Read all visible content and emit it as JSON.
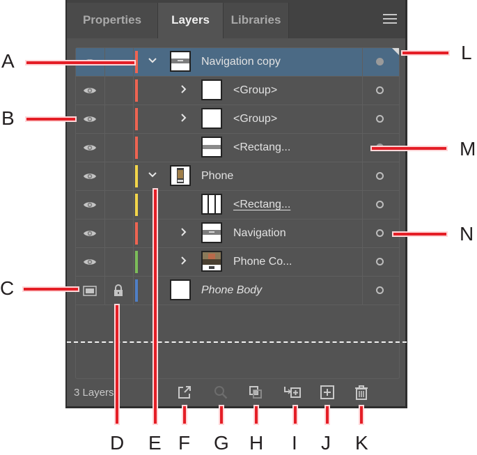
{
  "tabs": [
    {
      "label": "Properties",
      "active": false
    },
    {
      "label": "Layers",
      "active": true
    },
    {
      "label": "Libraries",
      "active": false
    }
  ],
  "menu_icon": "hamburger-menu-icon",
  "layers": [
    {
      "name": "Navigation copy",
      "indent": 0,
      "expanded": true,
      "has_toggle": true,
      "visible": true,
      "locked": false,
      "color": "#ee6452",
      "thumb": "navigation-bar",
      "target_filled": true,
      "selected": true,
      "italic": false,
      "underline": false
    },
    {
      "name": "<Group>",
      "indent": 1,
      "expanded": false,
      "has_toggle": true,
      "visible": true,
      "locked": false,
      "color": "#ee6452",
      "thumb": "blank",
      "target_filled": false,
      "selected": false,
      "italic": false,
      "underline": false
    },
    {
      "name": "<Group>",
      "indent": 1,
      "expanded": false,
      "has_toggle": true,
      "visible": true,
      "locked": false,
      "color": "#ee6452",
      "thumb": "blank",
      "target_filled": false,
      "selected": false,
      "italic": false,
      "underline": false
    },
    {
      "name": "<Rectang...",
      "indent": 1,
      "expanded": false,
      "has_toggle": false,
      "visible": true,
      "locked": false,
      "color": "#ee6452",
      "thumb": "gray-stripe",
      "target_filled": true,
      "selected": false,
      "italic": false,
      "underline": false
    },
    {
      "name": "Phone",
      "indent": 0,
      "expanded": true,
      "has_toggle": true,
      "visible": true,
      "locked": false,
      "color": "#f2d54a",
      "thumb": "phone",
      "target_filled": false,
      "selected": false,
      "italic": false,
      "underline": false
    },
    {
      "name": "<Rectang...",
      "indent": 1,
      "expanded": false,
      "has_toggle": false,
      "visible": true,
      "locked": false,
      "color": "#f2d54a",
      "thumb": "columns",
      "target_filled": false,
      "selected": false,
      "italic": false,
      "underline": true
    },
    {
      "name": "Navigation",
      "indent": 1,
      "expanded": false,
      "has_toggle": true,
      "visible": true,
      "locked": false,
      "color": "#ee6452",
      "thumb": "navigation-bar",
      "target_filled": false,
      "selected": false,
      "italic": false,
      "underline": false
    },
    {
      "name": "Phone Co...",
      "indent": 1,
      "expanded": false,
      "has_toggle": true,
      "visible": true,
      "locked": false,
      "color": "#7cbc5a",
      "thumb": "photo",
      "target_filled": false,
      "selected": false,
      "italic": false,
      "underline": false
    },
    {
      "name": "Phone Body",
      "indent": 0,
      "expanded": false,
      "has_toggle": false,
      "visible": false,
      "template": true,
      "locked": true,
      "color": "#4f7fc6",
      "thumb": "blank",
      "target_filled": false,
      "selected": false,
      "italic": true,
      "underline": false
    }
  ],
  "footer": {
    "layer_count": "3 Layers",
    "buttons": [
      {
        "name": "export-to-asset-export",
        "icon": "export-icon",
        "enabled": true
      },
      {
        "name": "locate-object",
        "icon": "search-icon",
        "enabled": false
      },
      {
        "name": "make-clipping-mask",
        "icon": "clipping-mask-icon",
        "enabled": true
      },
      {
        "name": "create-new-sublayer",
        "icon": "new-sublayer-icon",
        "enabled": true
      },
      {
        "name": "create-new-layer",
        "icon": "new-layer-icon",
        "enabled": true
      },
      {
        "name": "delete-selection",
        "icon": "trash-icon",
        "enabled": true
      }
    ]
  },
  "callouts": {
    "left": [
      "A",
      "B",
      "C"
    ],
    "bottom": [
      "D",
      "E",
      "F",
      "G",
      "H",
      "I",
      "J",
      "K"
    ],
    "right": [
      "L",
      "M",
      "N"
    ]
  },
  "colors": {
    "panel_bg": "#535353",
    "selected_row": "#4b6a85",
    "callout_red": "#e41e26"
  }
}
